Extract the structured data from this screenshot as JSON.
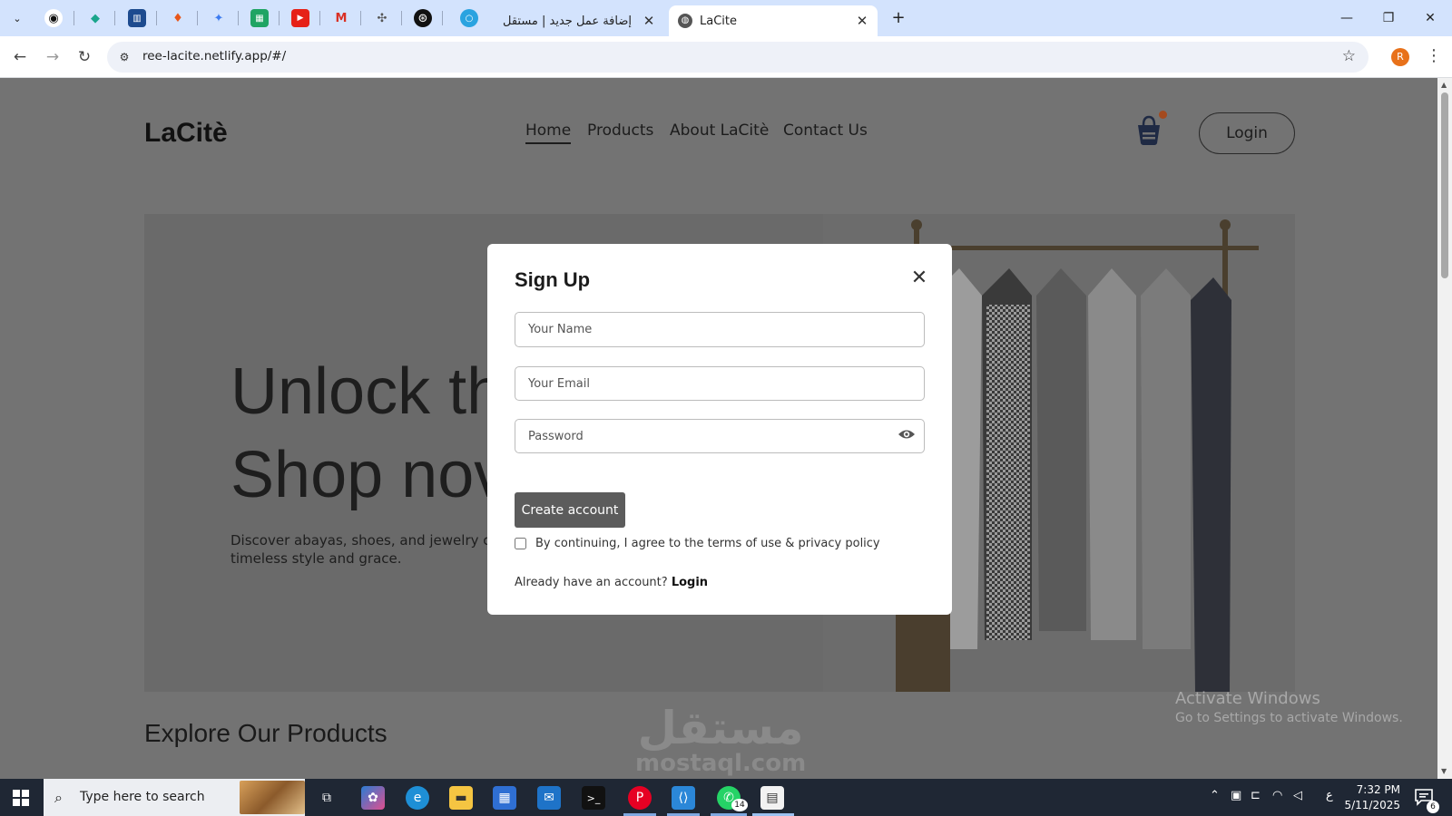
{
  "browser": {
    "tabs": [
      {
        "title": "إضافة عمل جديد | مستقل"
      },
      {
        "title": "LaCite"
      }
    ],
    "new_tab_label": "+",
    "address": "ree-lacite.netlify.app/#/",
    "profile_initial": "R"
  },
  "site": {
    "logo": "LaCitè",
    "nav": [
      "Home",
      "Products",
      "About LaCitè",
      "Contact Us"
    ],
    "login_label": "Login",
    "hero_title_line1": "Unlock th",
    "hero_title_line2": "Shop nov",
    "hero_desc_line1": "Discover abayas, shoes, and jewelry cra",
    "hero_desc_line2": "timeless style and grace.",
    "section_title": "Explore Our Products"
  },
  "modal": {
    "title": "Sign Up",
    "name_placeholder": "Your Name",
    "email_placeholder": "Your Email",
    "password_placeholder": "Password",
    "create_label": "Create account",
    "terms_text": "By continuing, I agree to the terms of use & privacy policy",
    "already_text": "Already have an account?",
    "login_link": "Login"
  },
  "overlay": {
    "activate_title": "Activate Windows",
    "activate_sub": "Go to Settings to activate Windows.",
    "mostaql_ar": "مستقل",
    "mostaql_en": "mostaql.com"
  },
  "taskbar": {
    "search_placeholder": "Type here to search",
    "time": "7:32 PM",
    "date": "5/11/2025",
    "lang": "ع",
    "whatsapp_badge": "14",
    "notif_badge": "6"
  },
  "colors": {
    "tabstrip": "#d3e3fd",
    "overlay_page": "#737373",
    "modal_button": "#5c5c5c",
    "cart_dot": "#a44a1e"
  }
}
